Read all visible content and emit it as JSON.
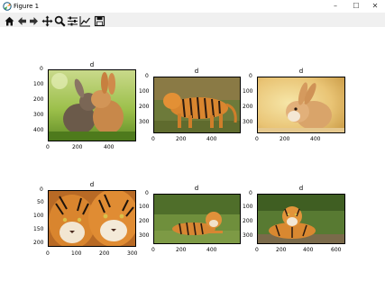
{
  "window": {
    "title": "Figure 1",
    "minimize": "–",
    "maximize": "☐",
    "close": "✕"
  },
  "toolbar": [
    "home-icon",
    "back-icon",
    "forward-icon",
    "pan-icon",
    "zoom-icon",
    "configure-subplots-icon",
    "edit-axes-icon",
    "save-icon"
  ],
  "subplots": [
    {
      "title": "d",
      "xticks": [
        "0",
        "200",
        "400"
      ],
      "yticks": [
        "0",
        "100",
        "200",
        "300",
        "400"
      ],
      "image": "rabbits"
    },
    {
      "title": "d",
      "xticks": [
        "0",
        "200",
        "400"
      ],
      "yticks": [
        "0",
        "100",
        "200",
        "300"
      ],
      "image": "tiger-walking"
    },
    {
      "title": "d",
      "xticks": [
        "0",
        "200",
        "400"
      ],
      "yticks": [
        "0",
        "100",
        "200",
        "300"
      ],
      "image": "bunny"
    },
    {
      "title": "d",
      "xticks": [
        "0",
        "100",
        "200",
        "300"
      ],
      "yticks": [
        "0",
        "50",
        "100",
        "150",
        "200"
      ],
      "image": "tigers-faces"
    },
    {
      "title": "d",
      "xticks": [
        "0",
        "200",
        "400"
      ],
      "yticks": [
        "0",
        "100",
        "200",
        "300"
      ],
      "image": "tiger-lying"
    },
    {
      "title": "d",
      "xticks": [
        "0",
        "200",
        "400",
        "600"
      ],
      "yticks": [
        "0",
        "100",
        "200",
        "300"
      ],
      "image": "tiger-sitting"
    }
  ]
}
